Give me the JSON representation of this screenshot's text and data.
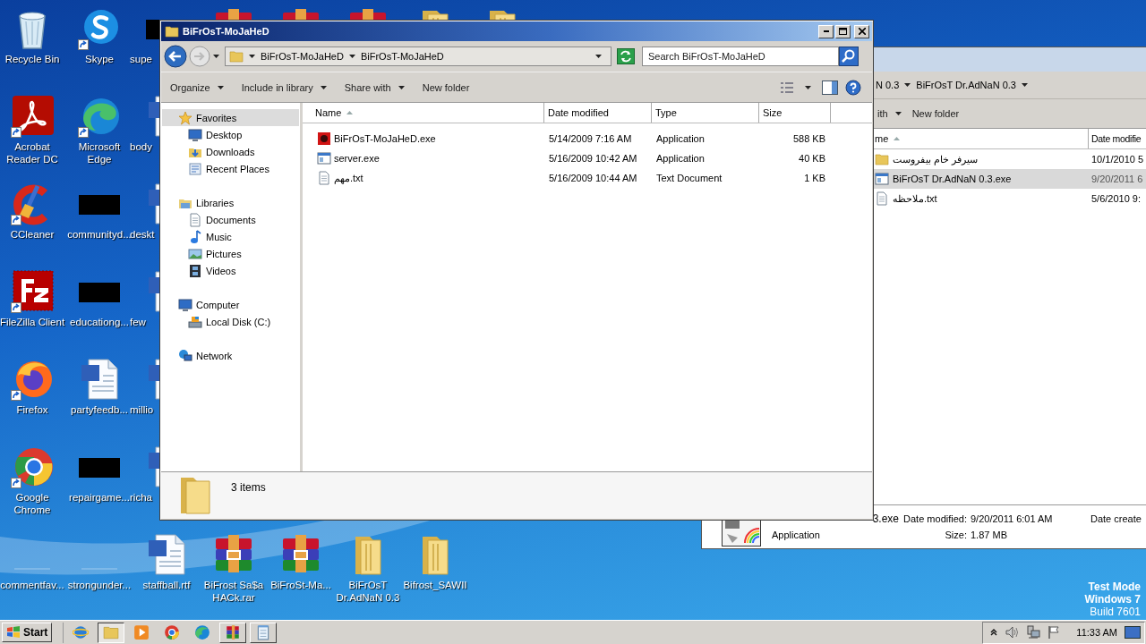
{
  "desktop": {
    "columns": [
      [
        {
          "label": "Recycle Bin",
          "kind": "recycle",
          "shortcut": false
        },
        {
          "label": "Acrobat Reader DC",
          "kind": "acrobat",
          "shortcut": true
        },
        {
          "label": "CCleaner",
          "kind": "ccleaner",
          "shortcut": true
        },
        {
          "label": "FileZilla Client",
          "kind": "filezilla",
          "shortcut": true
        },
        {
          "label": "Firefox",
          "kind": "firefox",
          "shortcut": true
        },
        {
          "label": "Google Chrome",
          "kind": "chrome",
          "shortcut": true
        },
        {
          "label": "commentfav...",
          "kind": "blank",
          "shortcut": false
        }
      ],
      [
        {
          "label": "Skype",
          "kind": "skype",
          "shortcut": true
        },
        {
          "label": "Microsoft Edge",
          "kind": "edge",
          "shortcut": true
        },
        {
          "label": "communityd...",
          "kind": "redacted",
          "shortcut": false
        },
        {
          "label": "educationg...",
          "kind": "redacted",
          "shortcut": false
        },
        {
          "label": "partyfeedb...",
          "kind": "word",
          "shortcut": false
        },
        {
          "label": "repairgame...",
          "kind": "redacted",
          "shortcut": false
        },
        {
          "label": "strongunder...",
          "kind": "blank",
          "shortcut": false
        }
      ],
      [
        {
          "label": "supe",
          "kind": "redacted",
          "shortcut": false
        },
        {
          "label": "body",
          "kind": "word",
          "shortcut": false
        },
        {
          "label": "deskt",
          "kind": "word",
          "shortcut": false
        },
        {
          "label": "few",
          "kind": "word",
          "shortcut": false
        },
        {
          "label": "millio",
          "kind": "word",
          "shortcut": false
        },
        {
          "label": "richa",
          "kind": "word",
          "shortcut": false
        },
        {
          "label": "staffball.rtf",
          "kind": "word",
          "shortcut": false
        }
      ]
    ],
    "top_row": [
      {
        "kind": "rar"
      },
      {
        "kind": "rar"
      },
      {
        "kind": "rar"
      },
      {
        "kind": "folder"
      },
      {
        "kind": "folder"
      }
    ],
    "bottom_row": [
      {
        "label": "BiFrost Sa$a HACk.rar",
        "kind": "rar"
      },
      {
        "label": "BiFroSt-Ma...",
        "kind": "rar"
      },
      {
        "label": "BiFrOsT Dr.AdNaN 0.3",
        "kind": "folder"
      },
      {
        "label": "Bifrost_SAWII",
        "kind": "folder"
      }
    ],
    "notice": [
      "Test Mode",
      "Windows 7",
      "Build 7601"
    ]
  },
  "explorer": {
    "title": "BiFrOsT-MoJaHeD",
    "breadcrumbs": [
      "BiFrOsT-MoJaHeD",
      "BiFrOsT-MoJaHeD"
    ],
    "search": {
      "placeholder": "Search BiFrOsT-MoJaHeD"
    },
    "toolbar": [
      {
        "label": "Organize",
        "dropdown": true
      },
      {
        "label": "Include in library",
        "dropdown": true
      },
      {
        "label": "Share with",
        "dropdown": true
      },
      {
        "label": "New folder",
        "dropdown": false
      }
    ],
    "nav": [
      {
        "label": "Favorites",
        "kind": "star",
        "selected": true,
        "children": [
          {
            "label": "Desktop",
            "kind": "desktop",
            "selected": false
          },
          {
            "label": "Downloads",
            "kind": "downloads",
            "selected": false
          },
          {
            "label": "Recent Places",
            "kind": "recent",
            "selected": false
          }
        ]
      },
      {
        "label": "Libraries",
        "kind": "libraries",
        "selected": false,
        "children": [
          {
            "label": "Documents",
            "kind": "documents",
            "selected": false
          },
          {
            "label": "Music",
            "kind": "music",
            "selected": false
          },
          {
            "label": "Pictures",
            "kind": "pictures",
            "selected": false
          },
          {
            "label": "Videos",
            "kind": "videos",
            "selected": false
          }
        ]
      },
      {
        "label": "Computer",
        "kind": "computer",
        "selected": false,
        "children": [
          {
            "label": "Local Disk (C:)",
            "kind": "disk",
            "selected": false
          }
        ]
      },
      {
        "label": "Network",
        "kind": "network",
        "selected": false
      }
    ],
    "columns": [
      {
        "label": "Name",
        "sorted": true
      },
      {
        "label": "Date modified",
        "sorted": false
      },
      {
        "label": "Type",
        "sorted": false
      },
      {
        "label": "Size",
        "sorted": false
      }
    ],
    "files": [
      {
        "kind": "exe-red",
        "name": "BiFrOsT-MoJaHeD.exe",
        "date": "5/14/2009 7:16 AM",
        "type": "Application",
        "size": "588 KB"
      },
      {
        "kind": "exe",
        "name": "server.exe",
        "date": "5/16/2009 10:42 AM",
        "type": "Application",
        "size": "40 KB"
      },
      {
        "kind": "txt",
        "name": "مهم.txt",
        "date": "5/16/2009 10:44 AM",
        "type": "Text Document",
        "size": "1 KB"
      }
    ],
    "status": "3 items"
  },
  "back_window": {
    "breadcrumbs": [
      "N 0.3",
      "BiFrOsT Dr.AdNaN 0.3"
    ],
    "toolbar": [
      {
        "label": "ith",
        "dropdown": true
      },
      {
        "label": "New folder",
        "dropdown": false
      }
    ],
    "columns": [
      {
        "label": "me",
        "sorted": true
      },
      {
        "label": "Date modifie",
        "sorted": false
      }
    ],
    "files": [
      {
        "kind": "folder",
        "name": "سیرفر خام بیفروست",
        "date": "10/1/2010 5",
        "selected": false
      },
      {
        "kind": "exe",
        "name": "BiFrOsT Dr.AdNaN 0.3.exe",
        "date": "9/20/2011 6",
        "selected": true
      },
      {
        "kind": "txt",
        "name": "ملاحظه.txt",
        "date": "5/6/2010 9:",
        "selected": false
      }
    ],
    "details": {
      "name": "3.exe",
      "type": "Application",
      "fields": [
        {
          "label": "Date modified:",
          "value": "9/20/2011 6:01 AM"
        },
        {
          "label": "Size:",
          "value": "1.87 MB"
        }
      ],
      "extra": "Date create"
    }
  },
  "taskbar": {
    "start": "Start",
    "items": [
      {
        "kind": "ie",
        "running": false,
        "active": false
      },
      {
        "kind": "folder",
        "running": true,
        "active": true
      },
      {
        "kind": "media",
        "running": false,
        "active": false
      },
      {
        "kind": "chrome",
        "running": false,
        "active": false
      },
      {
        "kind": "edge",
        "running": false,
        "active": false
      },
      {
        "kind": "rar",
        "running": true,
        "active": false
      },
      {
        "kind": "notepad",
        "running": true,
        "active": false
      }
    ],
    "clock": "11:33 AM"
  }
}
